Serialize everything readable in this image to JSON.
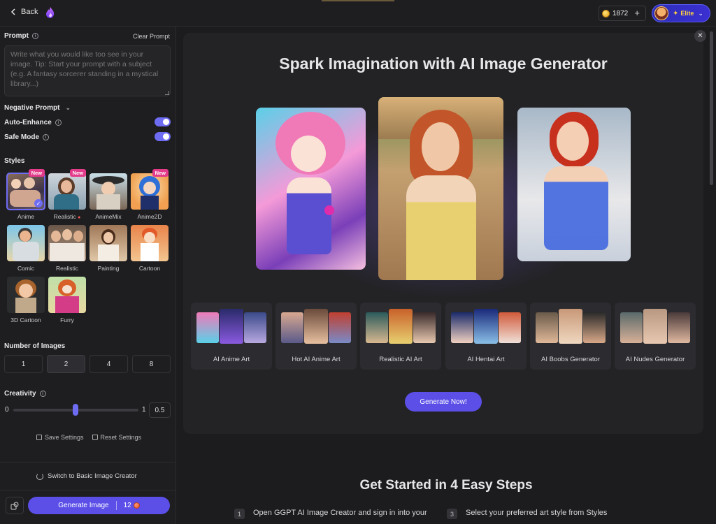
{
  "header": {
    "back_label": "Back",
    "credits": "1872",
    "credits_add": "+",
    "plan_label": "Elite"
  },
  "sidebar": {
    "prompt_label": "Prompt",
    "clear_prompt": "Clear Prompt",
    "prompt_placeholder": "Write what you would like too see in your image. Tip: Start your prompt with a subject (e.g. A fantasy sorcerer standing in a mystical library...)",
    "negative_prompt_label": "Negative Prompt",
    "auto_enhance_label": "Auto-Enhance",
    "safe_mode_label": "Safe Mode",
    "styles_label": "Styles",
    "styles": [
      {
        "name": "Anime",
        "badge": "New",
        "selected": true
      },
      {
        "name": "Realistic",
        "badge": "New",
        "selected": false
      },
      {
        "name": "AnimeMix",
        "badge": "",
        "selected": false
      },
      {
        "name": "Anime2D",
        "badge": "New",
        "selected": false
      },
      {
        "name": "Comic",
        "badge": "",
        "selected": false
      },
      {
        "name": "Realistic",
        "badge": "",
        "selected": false
      },
      {
        "name": "Painting",
        "badge": "",
        "selected": false
      },
      {
        "name": "Cartoon",
        "badge": "",
        "selected": false
      },
      {
        "name": "3D Cartoon",
        "badge": "",
        "selected": false
      },
      {
        "name": "Furry",
        "badge": "",
        "selected": false
      }
    ],
    "num_images_label": "Number of Images",
    "num_images_options": [
      "1",
      "2",
      "4",
      "8"
    ],
    "num_images_selected": "2",
    "creativity_label": "Creativity",
    "creativity_min": "0",
    "creativity_max": "1",
    "creativity_value": "0.5",
    "save_settings": "Save Settings",
    "reset_settings": "Reset Settings",
    "switch_basic": "Switch to Basic Image Creator",
    "generate_label": "Generate Image",
    "generate_cost": "12"
  },
  "main": {
    "hero_title": "Spark Imagination with AI Image Generator",
    "categories": [
      {
        "label": "AI Anime Art"
      },
      {
        "label": "Hot AI Anime Art"
      },
      {
        "label": "Realistic AI Art"
      },
      {
        "label": "AI Hentai Art"
      },
      {
        "label": "AI Boobs Generator"
      },
      {
        "label": "AI Nudes Generator"
      }
    ],
    "generate_now": "Generate Now!",
    "steps_title": "Get Started in 4 Easy Steps",
    "steps": [
      {
        "num": "1",
        "text": "Open GGPT AI Image Creator and sign in into your"
      },
      {
        "num": "3",
        "text": "Select your preferred art style from Styles"
      }
    ]
  },
  "colors": {
    "accent": "#5b4fe8",
    "toggle": "#6e6cf3",
    "badge": "#e23c8b",
    "elite_text": "#ffd23e"
  }
}
